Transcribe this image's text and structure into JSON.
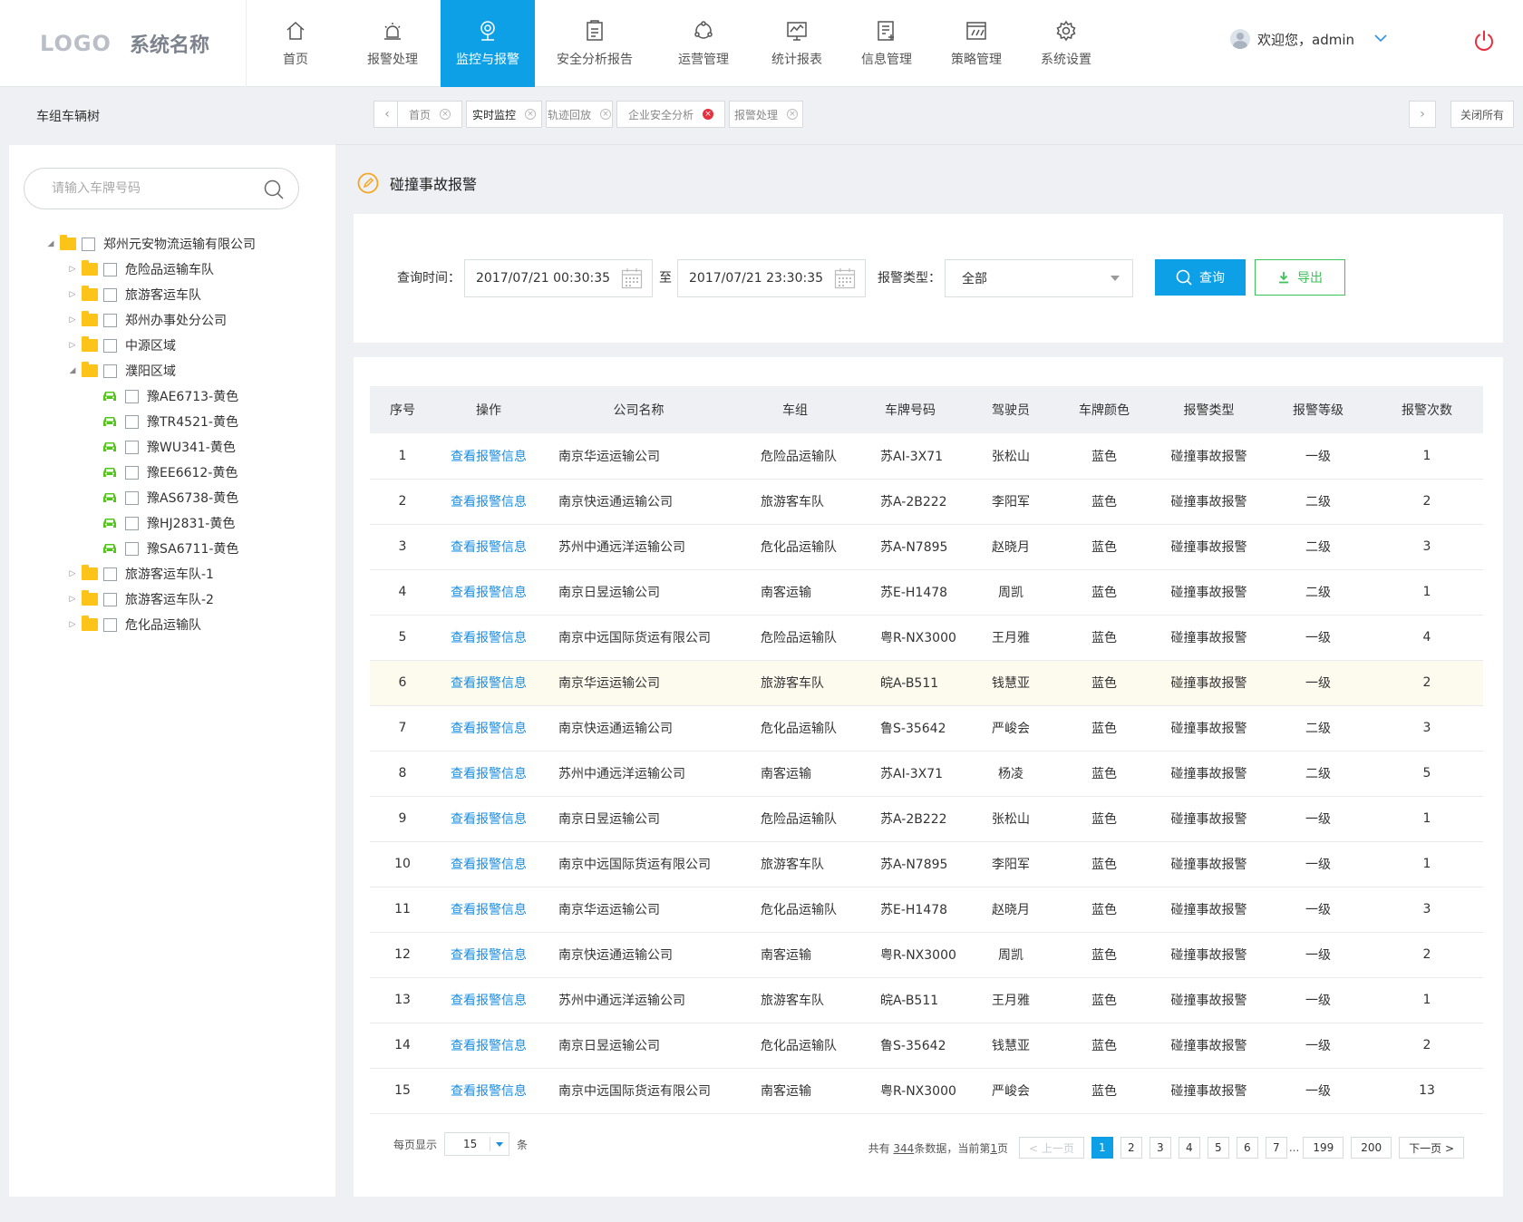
{
  "header": {
    "logo": "LOGO",
    "system_name": "系统名称",
    "nav": [
      {
        "label": "首页",
        "icon": "home-icon"
      },
      {
        "label": "报警处理",
        "icon": "alarm-icon"
      },
      {
        "label": "监控与报警",
        "icon": "monitor-icon",
        "active": true
      },
      {
        "label": "安全分析报告",
        "icon": "report-icon"
      },
      {
        "label": "运营管理",
        "icon": "operations-icon"
      },
      {
        "label": "统计报表",
        "icon": "chart-icon"
      },
      {
        "label": "信息管理",
        "icon": "info-icon"
      },
      {
        "label": "策略管理",
        "icon": "strategy-icon"
      },
      {
        "label": "系统设置",
        "icon": "gear-icon"
      }
    ],
    "user_greeting": "欢迎您，admin"
  },
  "sidebar": {
    "title": "车组车辆树",
    "search_placeholder": "请输入车牌号码",
    "tree": [
      {
        "label": "郑州元安物流运输有限公司",
        "level": 0,
        "expanded": true,
        "type": "folder"
      },
      {
        "label": "危险品运输车队",
        "level": 1,
        "type": "folder"
      },
      {
        "label": "旅游客运车队",
        "level": 1,
        "type": "folder"
      },
      {
        "label": "郑州办事处分公司",
        "level": 1,
        "type": "folder"
      },
      {
        "label": "中源区域",
        "level": 1,
        "type": "folder"
      },
      {
        "label": "濮阳区域",
        "level": 1,
        "expanded": true,
        "type": "folder"
      },
      {
        "label": "豫AE6713-黄色",
        "level": 2,
        "type": "vehicle"
      },
      {
        "label": "豫TR4521-黄色",
        "level": 2,
        "type": "vehicle"
      },
      {
        "label": "豫WU341-黄色",
        "level": 2,
        "type": "vehicle"
      },
      {
        "label": "豫EE6612-黄色",
        "level": 2,
        "type": "vehicle"
      },
      {
        "label": "豫AS6738-黄色",
        "level": 2,
        "type": "vehicle"
      },
      {
        "label": "豫HJ2831-黄色",
        "level": 2,
        "type": "vehicle"
      },
      {
        "label": "豫SA6711-黄色",
        "level": 2,
        "type": "vehicle"
      },
      {
        "label": "旅游客运车队-1",
        "level": 1,
        "type": "folder"
      },
      {
        "label": "旅游客运车队-2",
        "level": 1,
        "type": "folder"
      },
      {
        "label": "危化品运输队",
        "level": 1,
        "type": "folder"
      }
    ]
  },
  "tabs": [
    {
      "label": "首页",
      "active": false
    },
    {
      "label": "实时监控",
      "active": true
    },
    {
      "label": "轨迹回放",
      "active": false
    },
    {
      "label": "企业安全分析",
      "active": false,
      "close_red": true
    },
    {
      "label": "报警处理",
      "active": false
    }
  ],
  "close_all": "关闭所有",
  "page_title": "碰撞事故报警",
  "filter": {
    "time_label": "查询时间：",
    "start_time": "2017/07/21 00:30:35",
    "to_label": "至",
    "end_time": "2017/07/21 23:30:35",
    "type_label": "报警类型：",
    "type_value": "全部",
    "query_button": "查询",
    "export_button": "导出"
  },
  "table": {
    "headers": [
      "序号",
      "操作",
      "公司名称",
      "车组",
      "车牌号码",
      "驾驶员",
      "车牌颜色",
      "报警类型",
      "报警等级",
      "报警次数"
    ],
    "action_label": "查看报警信息",
    "rows": [
      [
        "1",
        "南京华运运输公司",
        "危险品运输队",
        "苏AI-3X71",
        "张松山",
        "蓝色",
        "碰撞事故报警",
        "一级",
        "1"
      ],
      [
        "2",
        "南京快运通运输公司",
        "旅游客车队",
        "苏A-2B222",
        "李阳军",
        "蓝色",
        "碰撞事故报警",
        "二级",
        "2"
      ],
      [
        "3",
        "苏州中通远洋运输公司",
        "危化品运输队",
        "苏A-N7895",
        "赵晓月",
        "蓝色",
        "碰撞事故报警",
        "二级",
        "3"
      ],
      [
        "4",
        "南京日昱运输公司",
        "南客运输",
        "苏E-H1478",
        "周凯",
        "蓝色",
        "碰撞事故报警",
        "二级",
        "1"
      ],
      [
        "5",
        "南京中远国际货运有限公司",
        "危险品运输队",
        "粤R-NX3000",
        "王月雅",
        "蓝色",
        "碰撞事故报警",
        "一级",
        "4"
      ],
      [
        "6",
        "南京华运运输公司",
        "旅游客车队",
        "皖A-B511",
        "钱慧亚",
        "蓝色",
        "碰撞事故报警",
        "一级",
        "2"
      ],
      [
        "7",
        "南京快运通运输公司",
        "危化品运输队",
        "鲁S-35642",
        "严峻会",
        "蓝色",
        "碰撞事故报警",
        "二级",
        "3"
      ],
      [
        "8",
        "苏州中通远洋运输公司",
        "南客运输",
        "苏AI-3X71",
        "杨凌",
        "蓝色",
        "碰撞事故报警",
        "二级",
        "5"
      ],
      [
        "9",
        "南京日昱运输公司",
        "危险品运输队",
        "苏A-2B222",
        "张松山",
        "蓝色",
        "碰撞事故报警",
        "一级",
        "1"
      ],
      [
        "10",
        "南京中远国际货运有限公司",
        "旅游客车队",
        "苏A-N7895",
        "李阳军",
        "蓝色",
        "碰撞事故报警",
        "一级",
        "1"
      ],
      [
        "11",
        "南京华运运输公司",
        "危化品运输队",
        "苏E-H1478",
        "赵晓月",
        "蓝色",
        "碰撞事故报警",
        "一级",
        "3"
      ],
      [
        "12",
        "南京快运通运输公司",
        "南客运输",
        "粤R-NX3000",
        "周凯",
        "蓝色",
        "碰撞事故报警",
        "一级",
        "2"
      ],
      [
        "13",
        "苏州中通远洋运输公司",
        "旅游客车队",
        "皖A-B511",
        "王月雅",
        "蓝色",
        "碰撞事故报警",
        "一级",
        "1"
      ],
      [
        "14",
        "南京日昱运输公司",
        "危化品运输队",
        "鲁S-35642",
        "钱慧亚",
        "蓝色",
        "碰撞事故报警",
        "一级",
        "2"
      ],
      [
        "15",
        "南京中远国际货运有限公司",
        "南客运输",
        "粤R-NX3000",
        "严峻会",
        "蓝色",
        "碰撞事故报警",
        "一级",
        "13"
      ]
    ],
    "highlight_row": 6
  },
  "pagination": {
    "per_page_label": "每页显示",
    "per_page": "15",
    "per_page_unit": "条",
    "info_prefix": "共有",
    "total": "344",
    "info_mid": "条数据，当前第",
    "current": "1",
    "info_suffix": "页",
    "prev": "< 上一页",
    "pages": [
      "1",
      "2",
      "3",
      "4",
      "5",
      "6",
      "7"
    ],
    "ellipsis": "...",
    "last_pages": [
      "199",
      "200"
    ],
    "next": "下一页 >"
  },
  "colors": {
    "primary": "#0ea0e6",
    "export_green": "#3ec25a",
    "link": "#1a8ee0",
    "folder": "#fcc419",
    "vehicle": "#52c41a",
    "power": "#e6303f"
  }
}
